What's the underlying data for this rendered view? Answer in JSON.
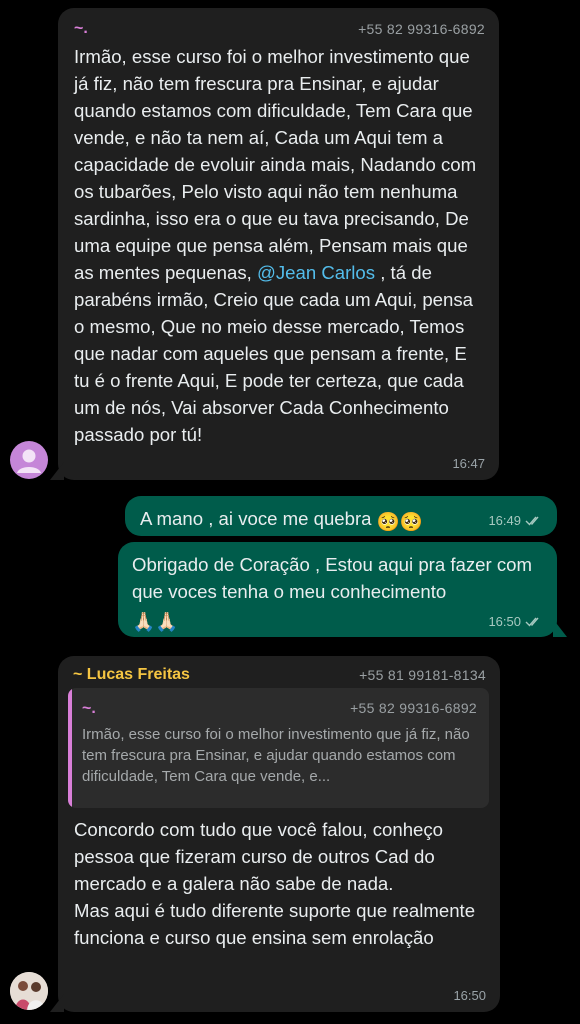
{
  "chat": {
    "messages": [
      {
        "sender_name": "~.",
        "sender_phone": "+55 82 99316-6892",
        "text_before": "Irmão, esse curso foi o melhor investimento que já fiz, não tem frescura pra Ensinar, e ajudar quando estamos com dificuldade, Tem Cara que vende, e não ta nem aí, Cada um Aqui tem a capacidade de evoluir ainda mais, Nadando com os tubarões, Pelo visto aqui não tem nenhuma sardinha, isso era o que eu tava precisando, De uma equipe que pensa além, Pensam mais que as mentes pequenas, ",
        "mention": "@Jean Carlos",
        "text_after": " , tá de parabéns irmão, Creio que cada um Aqui, pensa o mesmo, Que no meio desse mercado, Temos que nadar com aqueles que pensam a frente, E tu é o frente Aqui, E pode ter certeza, que cada um de nós, Vai absorver Cada Conhecimento passado por tú!",
        "time": "16:47"
      },
      {
        "text": "A mano , ai voce me quebra",
        "emoji": "🥺🥺",
        "time": "16:49"
      },
      {
        "text": "Obrigado de Coração , Estou aqui pra fazer com que voces tenha o meu conhecimento",
        "emoji": "🙏🏻🙏🏻",
        "time": "16:50"
      },
      {
        "sender_name": "~ Lucas Freitas",
        "sender_phone": "+55 81 99181-8134",
        "quote": {
          "sender_name": "~.",
          "sender_phone": "+55 82 99316-6892",
          "text": "Irmão, esse curso foi o melhor investimento que já fiz, não tem frescura pra Ensinar, e ajudar quando estamos com dificuldade, Tem Cara que vende, e..."
        },
        "text": "Concordo com tudo que você falou, conheço pessoa que fizeram curso de outros Cad do mercado e a galera não sabe de nada.\nMas aqui é tudo diferente suporte que realmente funciona e curso que ensina sem enrolação",
        "time": "16:50"
      }
    ]
  },
  "colors": {
    "incoming_bubble": "#1f1f1f",
    "outgoing_bubble": "#005c4b",
    "mention": "#53bdeb",
    "sender_1": "#d97fd8",
    "sender_2": "#f5c542"
  },
  "icons": {
    "read_ticks": "double-check-icon",
    "default_avatar": "person-icon",
    "photo_avatar": "avatar"
  }
}
